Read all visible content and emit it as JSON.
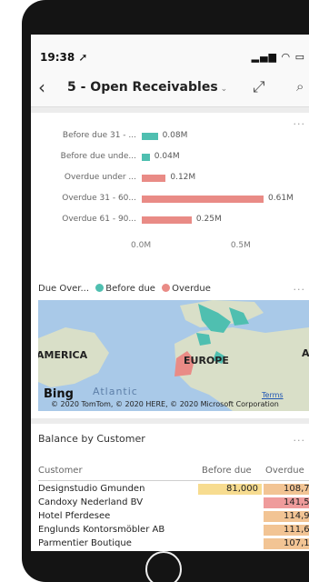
{
  "status": {
    "time": "19:38 ➚",
    "icons": "▂▄▆ ◠ ▭"
  },
  "header": {
    "back": "‹",
    "title": "5 - Open Receivables",
    "caret": "⌄",
    "expand": "⤢",
    "search": "⌕"
  },
  "more": "···",
  "bars": {
    "chart_data": {
      "type": "bar",
      "orientation": "horizontal",
      "categories": [
        "Before due 31 - ...",
        "Before due unde...",
        "Overdue under ...",
        "Overdue 31 - 60...",
        "Overdue 61 - 90..."
      ],
      "values": [
        0.08,
        0.04,
        0.12,
        0.61,
        0.25
      ],
      "value_labels": [
        "0.08M",
        "0.04M",
        "0.12M",
        "0.61M",
        "0.25M"
      ],
      "colors": [
        "#4fbfb0",
        "#4fbfb0",
        "#e98b86",
        "#e98b86",
        "#e98b86"
      ],
      "xlim": [
        0,
        0.61
      ],
      "x_ticks": [
        "0.0M",
        "0.5M"
      ],
      "x_tick_values": [
        0,
        0.5
      ],
      "title": "",
      "xlabel": "",
      "ylabel": ""
    }
  },
  "map": {
    "legend_title": "Due Over...",
    "legend": [
      {
        "label": "Before due",
        "color": "#4fbfb0"
      },
      {
        "label": "Overdue",
        "color": "#e98b86"
      }
    ],
    "labels": {
      "america": "AMERICA",
      "europe": "EUROPE",
      "a": "A",
      "ocean": "Atlantic"
    },
    "bing": "Bing",
    "terms": "Terms",
    "copyright": "© 2020 TomTom, © 2020 HERE, © 2020 Microsoft Corporation"
  },
  "table": {
    "title": "Balance by Customer",
    "columns": [
      "Customer",
      "Before due",
      "Overdue"
    ],
    "rows": [
      {
        "customer": "Designstudio Gmunden",
        "before": "81,000",
        "overdue": "108,7",
        "before_color": "#f7dc90",
        "overdue_color": "#f2c494"
      },
      {
        "customer": "Candoxy Nederland BV",
        "before": "",
        "overdue": "141,5",
        "before_color": "#ffffff",
        "overdue_color": "#ef9b9b"
      },
      {
        "customer": "Hotel Pferdesee",
        "before": "",
        "overdue": "114,9",
        "before_color": "#ffffff",
        "overdue_color": "#f2c494"
      },
      {
        "customer": "Englunds Kontorsmöbler AB",
        "before": "",
        "overdue": "111,6",
        "before_color": "#ffffff",
        "overdue_color": "#f2c494"
      },
      {
        "customer": "Parmentier Boutique",
        "before": "",
        "overdue": "107,1",
        "before_color": "#ffffff",
        "overdue_color": "#f2c494"
      }
    ]
  }
}
